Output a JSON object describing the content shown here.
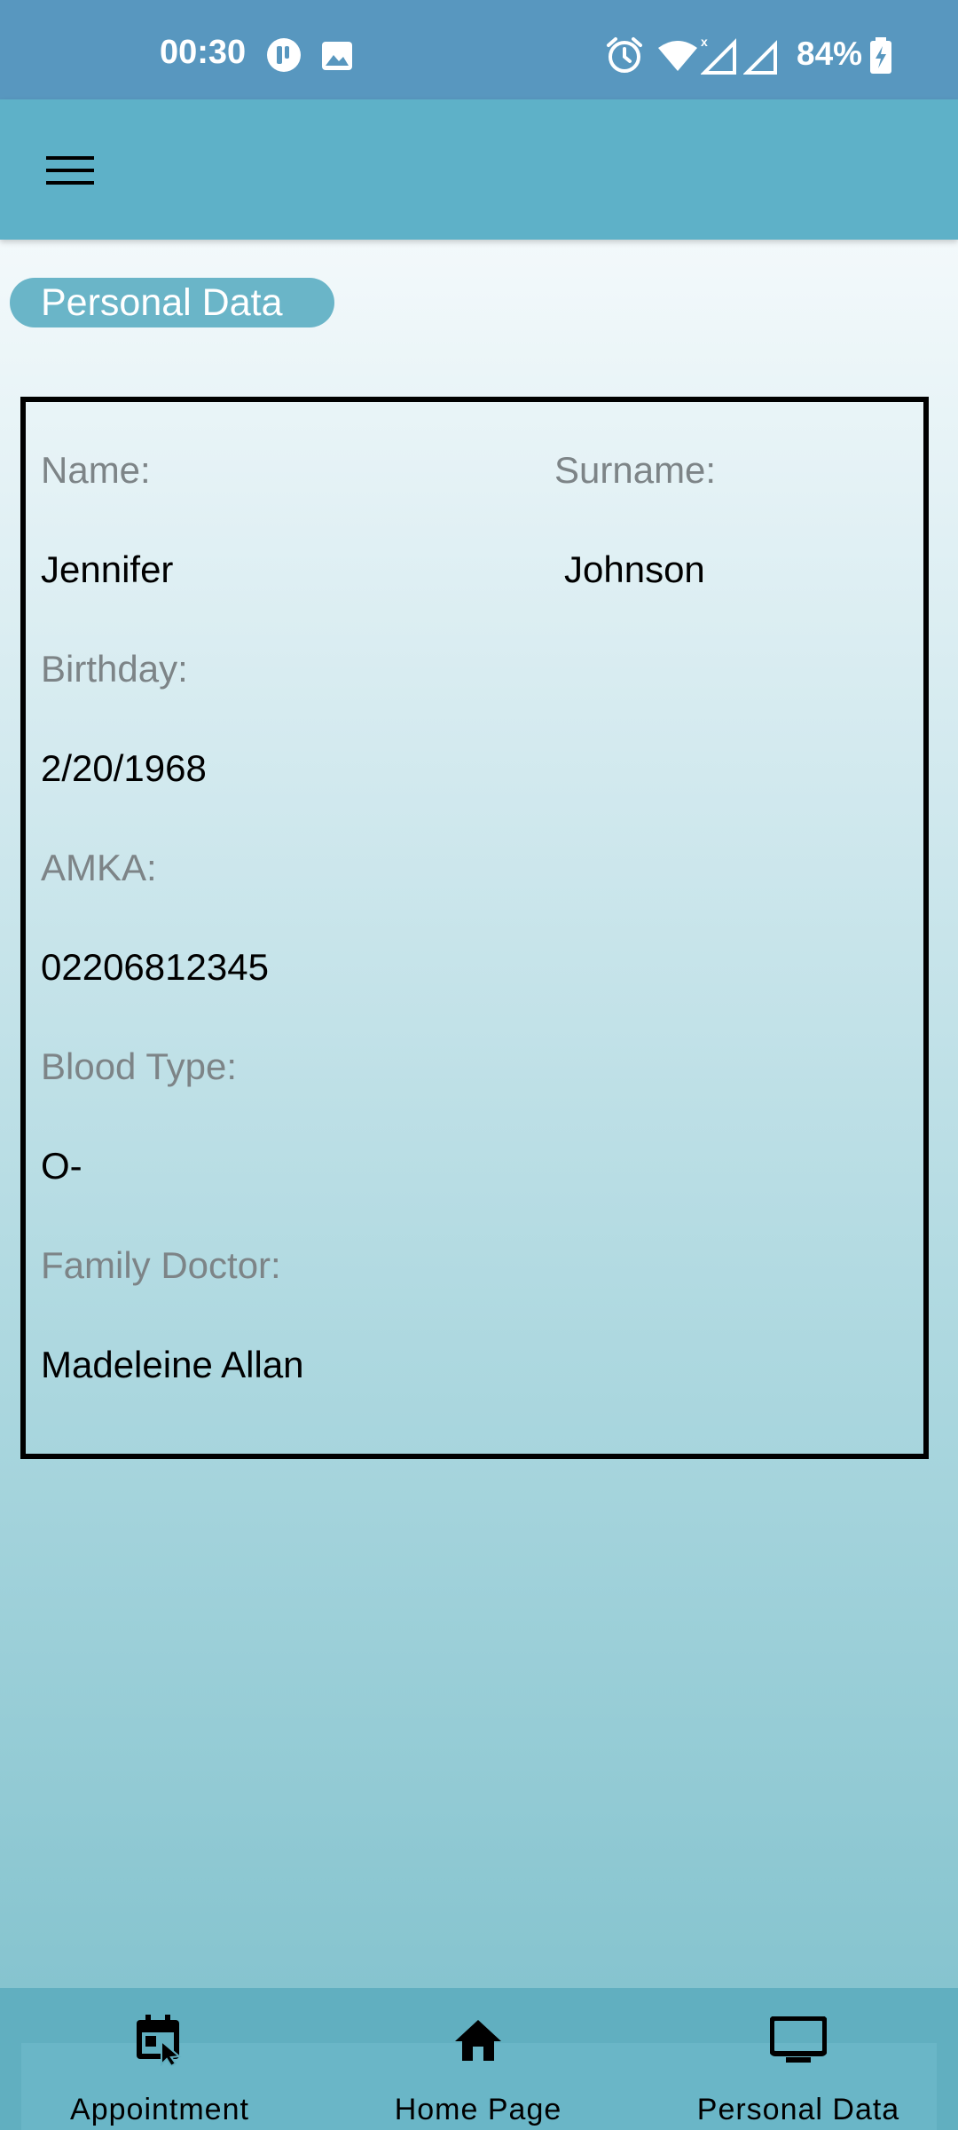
{
  "status_bar": {
    "time": "00:30",
    "battery": "84%"
  },
  "app_bar": {
    "menu_icon": "hamburger-menu-icon"
  },
  "page_chip": {
    "label": "Personal Data"
  },
  "personal_data": {
    "name_label": "Name:",
    "name_value": "Jennifer",
    "surname_label": "Surname:",
    "surname_value": "Johnson",
    "birthday_label": "Birthday:",
    "birthday_value": "2/20/1968",
    "amka_label": "AMKA:",
    "amka_value": "02206812345",
    "blood_type_label": "Blood Type:",
    "blood_type_value": "O-",
    "family_doctor_label": "Family Doctor:",
    "family_doctor_value": "Madeleine Allan"
  },
  "bottom_nav": {
    "items": [
      {
        "label": "Appointment",
        "icon": "calendar-cursor-icon"
      },
      {
        "label": "Home Page",
        "icon": "home-icon"
      },
      {
        "label": "Personal Data",
        "icon": "monitor-icon"
      }
    ]
  },
  "colors": {
    "status_bar": "#5897bf",
    "app_bar": "#5eb1c8",
    "chip": "#6ab5c8",
    "label_text": "#7d8487",
    "bottom_nav": "#61afc0"
  }
}
